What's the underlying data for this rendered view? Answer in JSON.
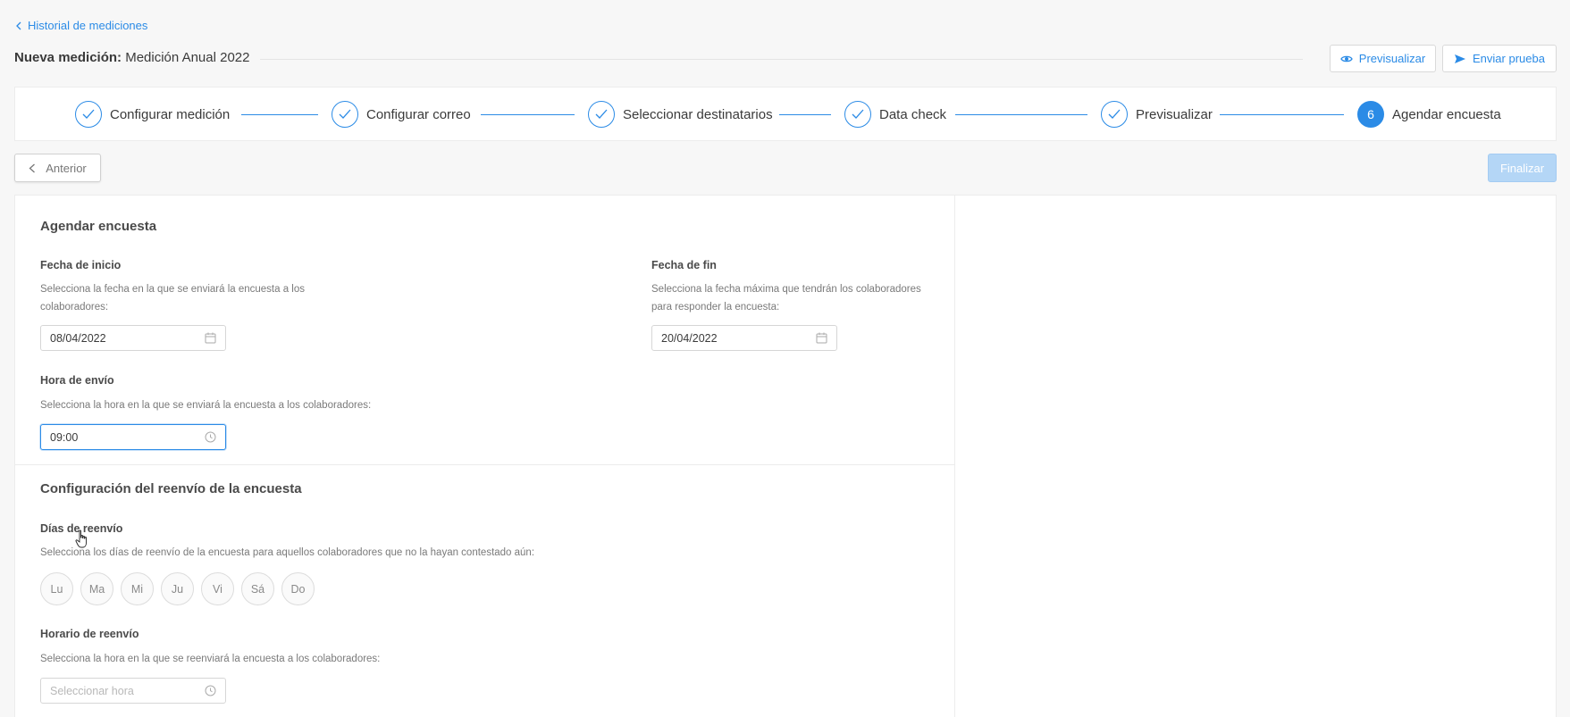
{
  "nav": {
    "back_label": "Historial de mediciones"
  },
  "header": {
    "title_prefix": "Nueva medición:",
    "title_name": "Medición Anual 2022",
    "preview_label": "Previsualizar",
    "send_test_label": "Enviar prueba"
  },
  "stepper": {
    "steps": [
      {
        "label": "Configurar medición",
        "status": "done"
      },
      {
        "label": "Configurar correo",
        "status": "done"
      },
      {
        "label": "Seleccionar destinatarios",
        "status": "done"
      },
      {
        "label": "Data check",
        "status": "done"
      },
      {
        "label": "Previsualizar",
        "status": "done"
      },
      {
        "label": "Agendar encuesta",
        "status": "active",
        "number": "6"
      }
    ]
  },
  "actions": {
    "prev_label": "Anterior",
    "finish_label": "Finalizar"
  },
  "schedule": {
    "title": "Agendar encuesta",
    "start": {
      "label": "Fecha de inicio",
      "desc_line1": "Selecciona la fecha en la que se enviará la encuesta a los",
      "desc_line2": "colaboradores:",
      "value": "08/04/2022"
    },
    "end": {
      "label": "Fecha de fin",
      "desc_line1": "Selecciona la fecha máxima que tendrán los colaboradores",
      "desc_line2": "para responder la encuesta:",
      "value": "20/04/2022"
    },
    "time": {
      "label": "Hora de envío",
      "desc": "Selecciona la hora en la que se enviará la encuesta a los colaboradores:",
      "value": "09:00"
    }
  },
  "resend": {
    "title": "Configuración del reenvío de la encuesta",
    "days": {
      "label": "Días de reenvío",
      "desc": "Selecciona los días de reenvío de la encuesta para aquellos colaboradores que no la hayan contestado aún:",
      "items": [
        "Lu",
        "Ma",
        "Mi",
        "Ju",
        "Vi",
        "Sá",
        "Do"
      ]
    },
    "time": {
      "label": "Horario de reenvío",
      "desc": "Selecciona la hora en la que se reenviará la encuesta a los colaboradores:",
      "placeholder": "Seleccionar hora"
    }
  },
  "colors": {
    "accent": "#2b8be6",
    "finish_disabled": "#b4d6f6"
  }
}
